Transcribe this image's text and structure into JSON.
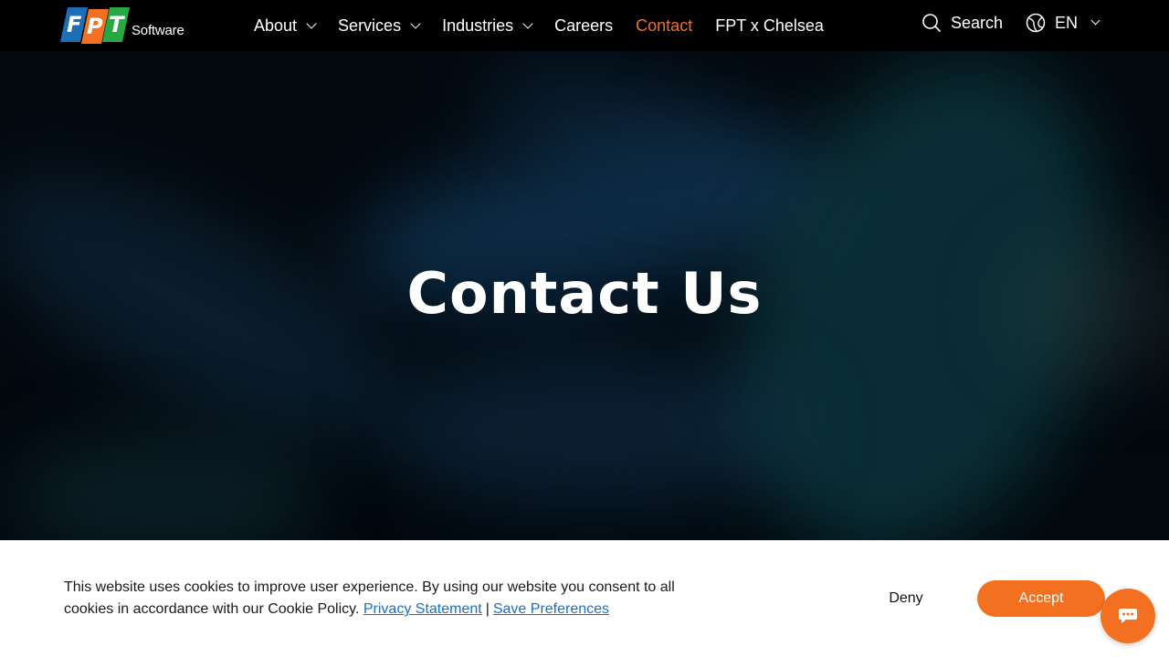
{
  "header": {
    "logo": {
      "letters": [
        "F",
        "P",
        "T"
      ],
      "word": "Software"
    },
    "nav": [
      {
        "label": "About",
        "dropdown": true
      },
      {
        "label": "Services",
        "dropdown": true
      },
      {
        "label": "Industries",
        "dropdown": true
      },
      {
        "label": "Careers",
        "dropdown": false
      },
      {
        "label": "Contact",
        "dropdown": false,
        "active": true
      },
      {
        "label": "FPT x Chelsea",
        "dropdown": false
      }
    ],
    "search_label": "Search",
    "language": "EN"
  },
  "hero": {
    "title": "Contact Us"
  },
  "cookie_banner": {
    "message": "This website uses cookies to improve user experience. By using our website you consent to all cookies in accordance with our Cookie Policy.",
    "privacy_link": "Privacy Statement",
    "separator": "|",
    "preferences_link": "Save Preferences",
    "deny_label": "Deny",
    "accept_label": "Accept"
  },
  "colors": {
    "accent": "#f37021",
    "link": "#1b6fc4",
    "header_bg": "#000000",
    "logo_blue": "#1c6fb6",
    "logo_orange": "#f37021",
    "logo_green": "#28a745"
  },
  "icons": {
    "search": "search-icon",
    "language": "globe-icon",
    "chat": "chat-bubble-icon"
  }
}
